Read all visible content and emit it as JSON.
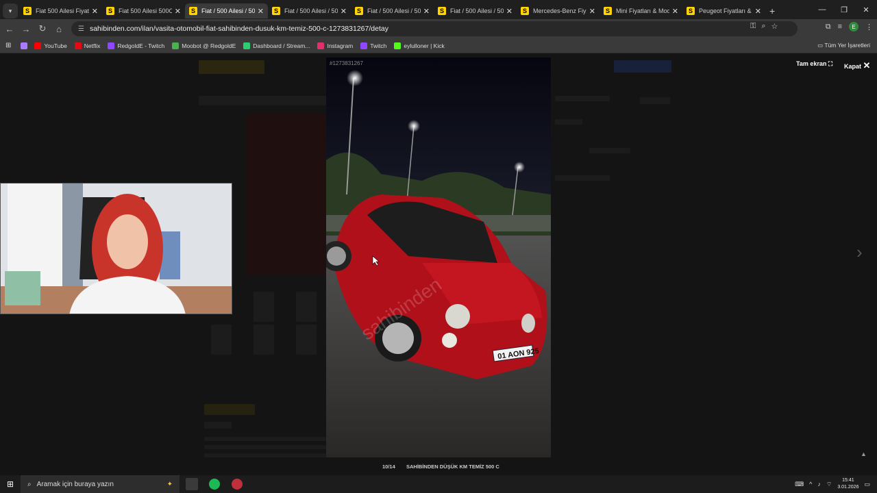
{
  "tabs": [
    {
      "title": "Fiat 500 Ailesi Fiyatları",
      "active": false
    },
    {
      "title": "Fiat 500 Ailesi 500C",
      "active": false
    },
    {
      "title": "Fiat / 500 Ailesi / 500",
      "active": true
    },
    {
      "title": "Fiat / 500 Ailesi / 500",
      "active": false
    },
    {
      "title": "Fiat / 500 Ailesi / 500",
      "active": false
    },
    {
      "title": "Fiat / 500 Ailesi / 500",
      "active": false
    },
    {
      "title": "Mercedes-Benz Fiyatl",
      "active": false
    },
    {
      "title": "Mini Fiyatları & Mod",
      "active": false
    },
    {
      "title": "Peugeot Fiyatları & M",
      "active": false
    }
  ],
  "tab_favicon": "S",
  "url": "sahibinden.com/ilan/vasita-otomobil-fiat-sahibinden-dusuk-km-temiz-500-c-1273831267/detay",
  "bookmarks": [
    {
      "label": "YouTube",
      "color": "#ff0000"
    },
    {
      "label": "Netflix",
      "color": "#e50914"
    },
    {
      "label": "RedgoldE - Twitch",
      "color": "#9146ff"
    },
    {
      "label": "Moobot @ RedgoldE",
      "color": "#4caf50"
    },
    {
      "label": "Dashboard / Stream...",
      "color": "#2ecc71"
    },
    {
      "label": "Instagram",
      "color": "#e1306c"
    },
    {
      "label": "Twitch",
      "color": "#9146ff"
    },
    {
      "label": "eylulloner | Kick",
      "color": "#53fc18"
    }
  ],
  "all_bookmarks": "Tüm Yer İşaretleri",
  "viewer": {
    "photo_id": "#1273831267",
    "fullscreen_label": "Tam ekran",
    "close_label": "Kapat",
    "counter": "10/14",
    "caption": "SAHİBİNDEN DÜŞÜK KM TEMİZ 500 C",
    "plate": "01 AON 925",
    "watermark": "sahibinden"
  },
  "taskbar": {
    "search_placeholder": "Aramak için buraya yazın",
    "time": "15:41",
    "date": "3.01.2026"
  }
}
